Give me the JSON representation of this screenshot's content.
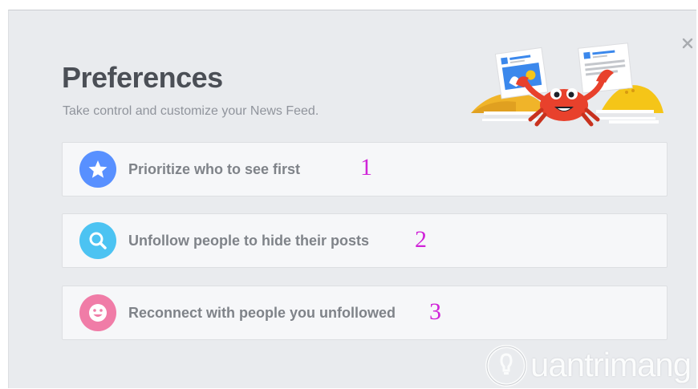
{
  "dialog": {
    "title": "Preferences",
    "subtitle": "Take control and customize your News Feed.",
    "close_icon": "close-x-icon"
  },
  "options": [
    {
      "label": "Prioritize who to see first",
      "icon": "star-icon",
      "color": "#5890ff"
    },
    {
      "label": "Unfollow people to hide their posts",
      "icon": "magnifier-icon",
      "color": "#4cc3f2"
    },
    {
      "label": "Reconnect with people you unfollowed",
      "icon": "smiley-icon",
      "color": "#f07ca7"
    }
  ],
  "annotations": [
    "1",
    "2",
    "3"
  ],
  "annotation_color": "#d024d8",
  "watermark": {
    "text": "uantrimang"
  }
}
